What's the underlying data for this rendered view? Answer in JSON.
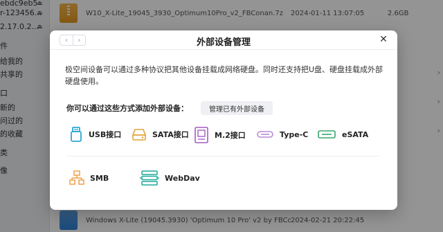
{
  "background": {
    "sidebar_items": [
      {
        "label": "ebdc9eb5",
        "eject": "⏏"
      },
      {
        "label": "r-123456...",
        "eject": "⏏"
      },
      {
        "label": "2.17.0.2...",
        "eject": "⏏"
      },
      {
        "label": "件",
        "eject": ""
      },
      {
        "label": "给我的",
        "eject": ""
      },
      {
        "label": "共享的",
        "eject": ""
      },
      {
        "label": "口",
        "eject": ""
      },
      {
        "label": "新的",
        "eject": ""
      },
      {
        "label": "问过的",
        "eject": ""
      },
      {
        "label": "的收藏",
        "eject": ""
      },
      {
        "label": "类",
        "eject": ""
      },
      {
        "label": "像",
        "eject": ""
      }
    ],
    "files": [
      {
        "name": "W10_X-Lite_19045_3930_Optimum10Pro_v2_FBConan.7z",
        "date": "2024-01-11 13:07:05",
        "size": "2.6GB",
        "icon": "archive-file-icon"
      },
      {
        "name": "Windows X-Lite (19045.3930) 'Optimum 10 Pro' v2 by FBConan",
        "date": "2024-02-21 20:22:45",
        "size": "",
        "icon": "disc-image-file-icon"
      }
    ]
  },
  "modal": {
    "title": "外部设备管理",
    "nav_back": "‹",
    "nav_forward": "›",
    "close": "✕",
    "description": "极空间设备可以通过多种协议把其他设备挂载成网络硬盘。同时还支持把U盘、硬盘挂载成外部硬盘使用。",
    "methods_label": "你可以通过这些方式添加外部设备：",
    "manage_button": "管理已有外部设备",
    "interfaces": [
      {
        "label": "USB接口",
        "icon": "usb-icon"
      },
      {
        "label": "SATA接口",
        "icon": "sata-drive-icon"
      },
      {
        "label": "M.2接口",
        "icon": "m2-ssd-icon"
      },
      {
        "label": "Type-C",
        "icon": "type-c-icon"
      },
      {
        "label": "eSATA",
        "icon": "esata-icon"
      }
    ],
    "protocols": [
      {
        "label": "SMB",
        "icon": "network-share-icon"
      },
      {
        "label": "WebDav",
        "icon": "webdav-server-icon"
      }
    ]
  },
  "colors": {
    "usb": "#2aa8d6",
    "sata": "#e0a23a",
    "m2": "#a35cc4",
    "type_c": "#b98ad6",
    "esata": "#3aa56a",
    "smb": "#f0a04a",
    "webdav": "#1fa99a"
  }
}
